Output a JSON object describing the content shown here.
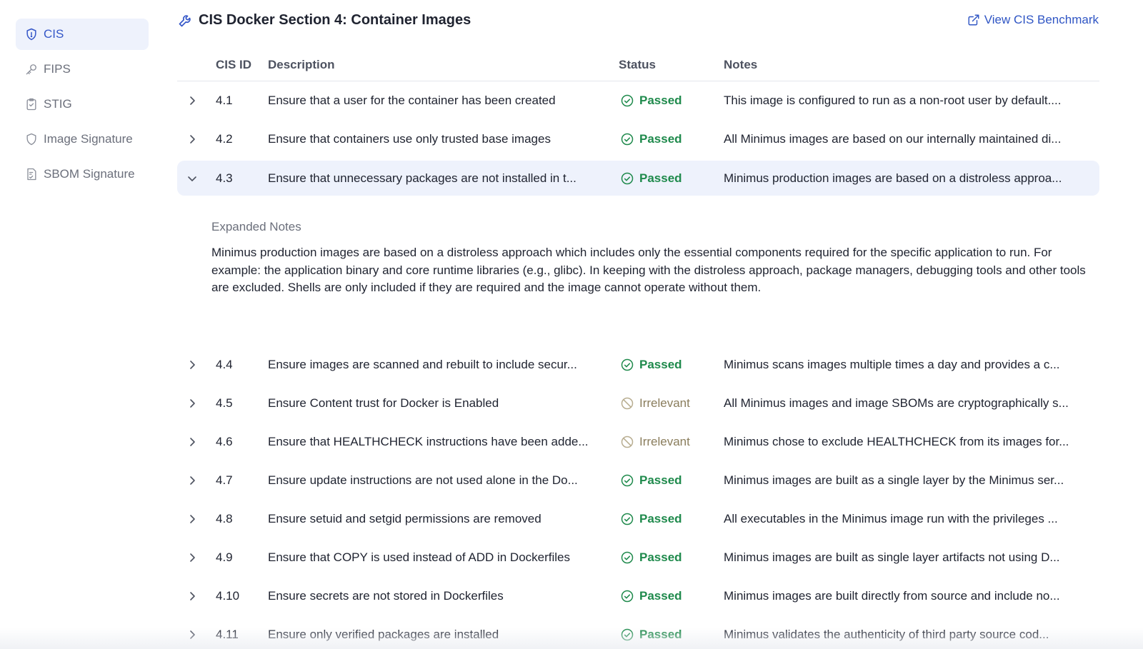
{
  "sidebar": {
    "items": [
      {
        "label": "CIS",
        "icon": "shield-icon",
        "active": true
      },
      {
        "label": "FIPS",
        "icon": "key-icon",
        "active": false
      },
      {
        "label": "STIG",
        "icon": "clipboard-check-icon",
        "active": false
      },
      {
        "label": "Image Signature",
        "icon": "shield-outline-icon",
        "active": false
      },
      {
        "label": "SBOM Signature",
        "icon": "document-check-icon",
        "active": false
      }
    ]
  },
  "header": {
    "title": "CIS Docker Section 4: Container Images",
    "title_icon": "wrench-icon",
    "link_label": "View CIS Benchmark",
    "link_icon": "external-link-icon"
  },
  "table": {
    "columns": {
      "id": "CIS ID",
      "description": "Description",
      "status": "Status",
      "notes": "Notes"
    },
    "rows": [
      {
        "id": "4.1",
        "description": "Ensure that a user for the container has been created",
        "status": "Passed",
        "notes": "This image is configured to run as a non-root user by default...."
      },
      {
        "id": "4.2",
        "description": "Ensure that containers use only trusted base images",
        "status": "Passed",
        "notes": "All Minimus images are based on our internally maintained di..."
      },
      {
        "id": "4.3",
        "description": "Ensure that unnecessary packages are not installed in t...",
        "status": "Passed",
        "notes": "Minimus production images are based on a distroless approa..."
      },
      {
        "id": "4.4",
        "description": "Ensure images are scanned and rebuilt to include secur...",
        "status": "Passed",
        "notes": "Minimus scans images multiple times a day and provides a c..."
      },
      {
        "id": "4.5",
        "description": "Ensure Content trust for Docker is Enabled",
        "status": "Irrelevant",
        "notes": "All Minimus images and image SBOMs are cryptographically s..."
      },
      {
        "id": "4.6",
        "description": "Ensure that HEALTHCHECK instructions have been adde...",
        "status": "Irrelevant",
        "notes": "Minimus chose to exclude HEALTHCHECK from its images for..."
      },
      {
        "id": "4.7",
        "description": "Ensure update instructions are not used alone in the Do...",
        "status": "Passed",
        "notes": "Minimus images are built as a single layer by the Minimus ser..."
      },
      {
        "id": "4.8",
        "description": "Ensure setuid and setgid permissions are removed",
        "status": "Passed",
        "notes": "All executables in the Minimus image run with the privileges ..."
      },
      {
        "id": "4.9",
        "description": "Ensure that COPY is used instead of ADD in Dockerfiles",
        "status": "Passed",
        "notes": "Minimus images are built as single layer artifacts not using D..."
      },
      {
        "id": "4.10",
        "description": "Ensure secrets are not stored in Dockerfiles",
        "status": "Passed",
        "notes": "Minimus images are built directly from source and include no..."
      },
      {
        "id": "4.11",
        "description": "Ensure only verified packages are installed",
        "status": "Passed",
        "notes": "Minimus validates the authenticity of third party source cod..."
      }
    ],
    "expanded": {
      "heading": "Expanded Notes",
      "body": "Minimus production images are based on a distroless approach which includes only the essential components required for the specific application to run. For example: the application binary and core runtime libraries (e.g., glibc). In keeping with the distroless approach, package managers, debugging tools and other tools are excluded. Shells are only included if they are required and the image cannot operate without them."
    }
  },
  "colors": {
    "accent": "#2f55c4",
    "active_bg": "#eef2fc",
    "passed": "#1f8a4c",
    "irrelevant": "#8a7d5c"
  }
}
